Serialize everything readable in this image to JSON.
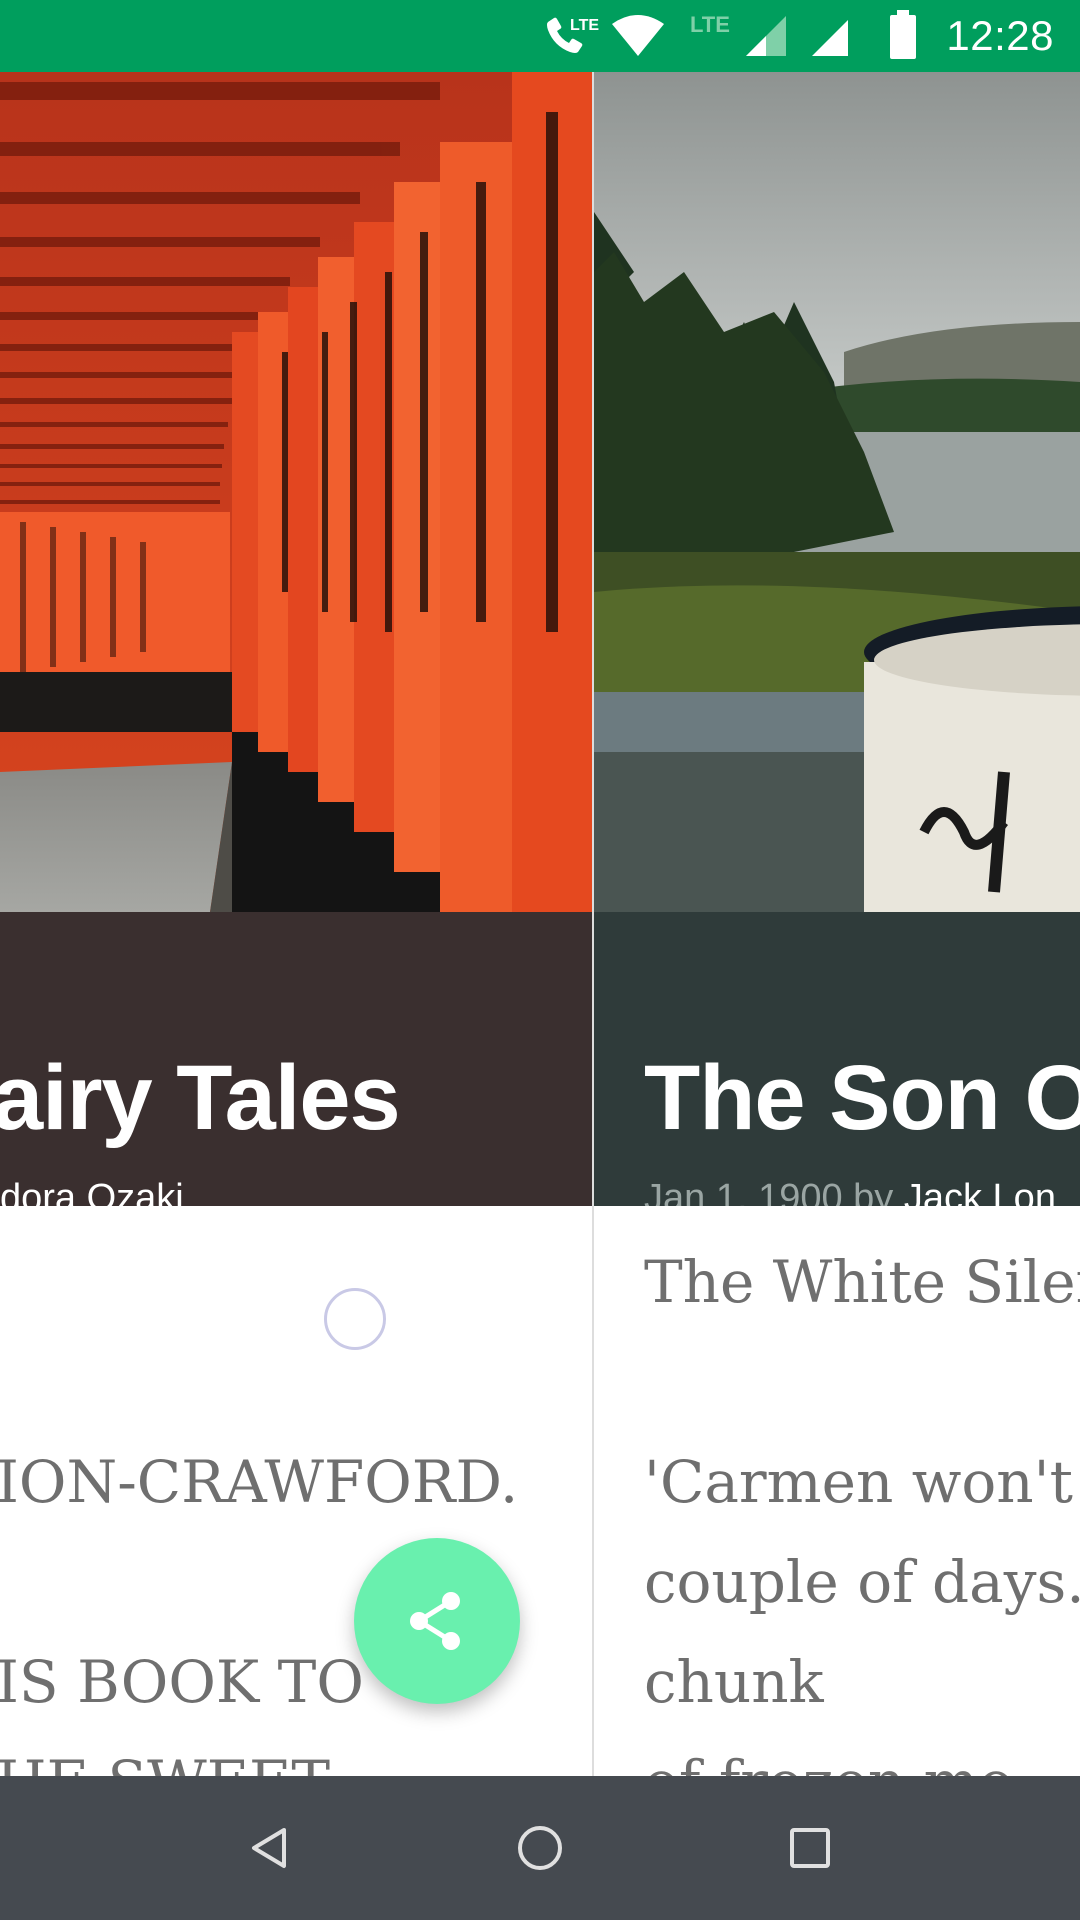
{
  "status_bar": {
    "time": "12:28",
    "network_label_1": "LTE",
    "network_label_2": "LTE",
    "color": "#009e5d"
  },
  "cards": [
    {
      "title": "airy Tales",
      "meta_author": "dora Ozaki",
      "band_color": "#3a2f2f",
      "body_lines": [
        "",
        "",
        "ION-CRAWFORD.",
        "",
        "IS BOOK TO",
        "HE SWEET"
      ]
    },
    {
      "title": "The Son Of",
      "meta_date": "Jan 1, 1900 by ",
      "meta_author": "Jack Lon",
      "band_color": "#2f3b3a",
      "body_lines": [
        "The White Silen",
        "",
        "'Carmen won't l",
        "couple of days.'",
        "chunk",
        "of frozen mo"
      ]
    }
  ],
  "fab": {
    "icon": "share-icon",
    "color": "#69f0ae"
  },
  "nav_bar": {
    "back": "back-icon",
    "home": "home-icon",
    "recents": "recents-icon",
    "color": "#454a50"
  }
}
